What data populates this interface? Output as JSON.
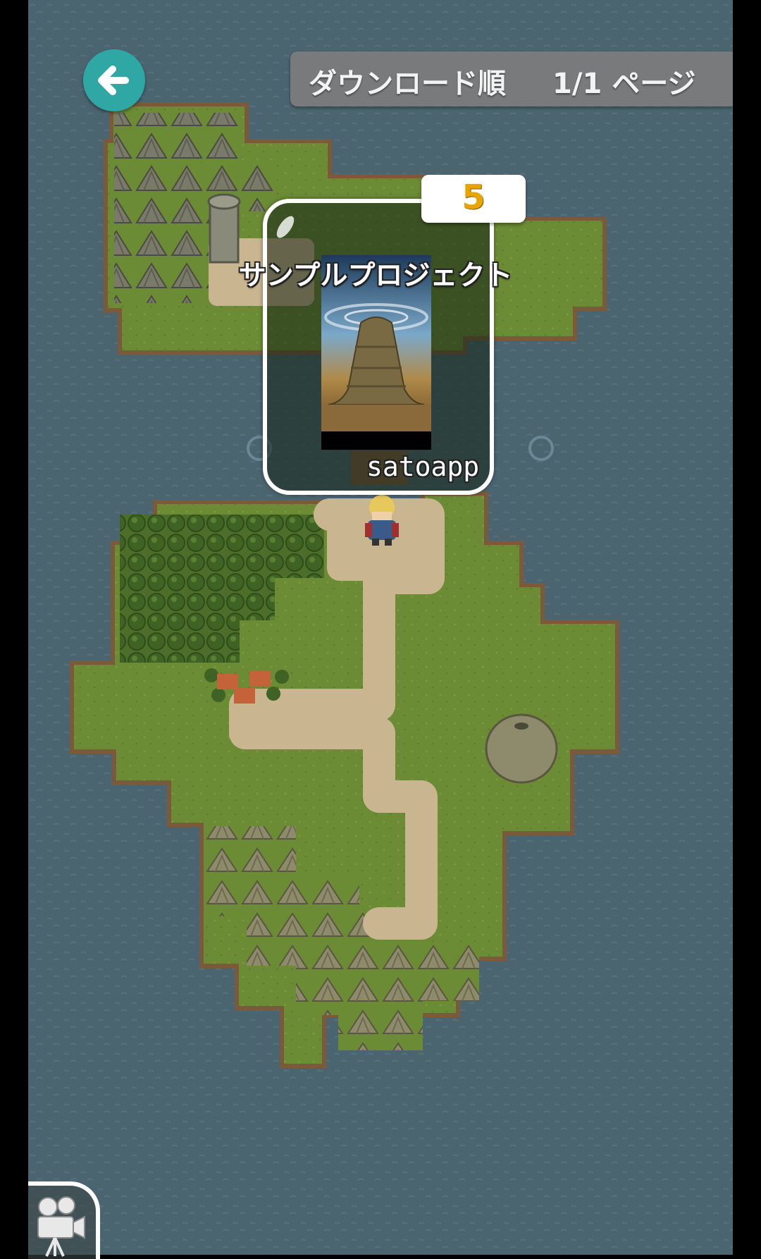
{
  "header": {
    "sort_label": "ダウンロード順",
    "page_label": "1/1 ページ"
  },
  "project": {
    "title": "サンプルプロジェクト",
    "author": "satoapp",
    "count": "5"
  },
  "icons": {
    "back": "arrow-left-icon",
    "movie": "movie-camera-icon"
  },
  "colors": {
    "accent": "#2fa8a5",
    "count": "#e8a400",
    "sea": "#4a6470",
    "grass": "#6a8a34",
    "path": "#c9b590"
  }
}
